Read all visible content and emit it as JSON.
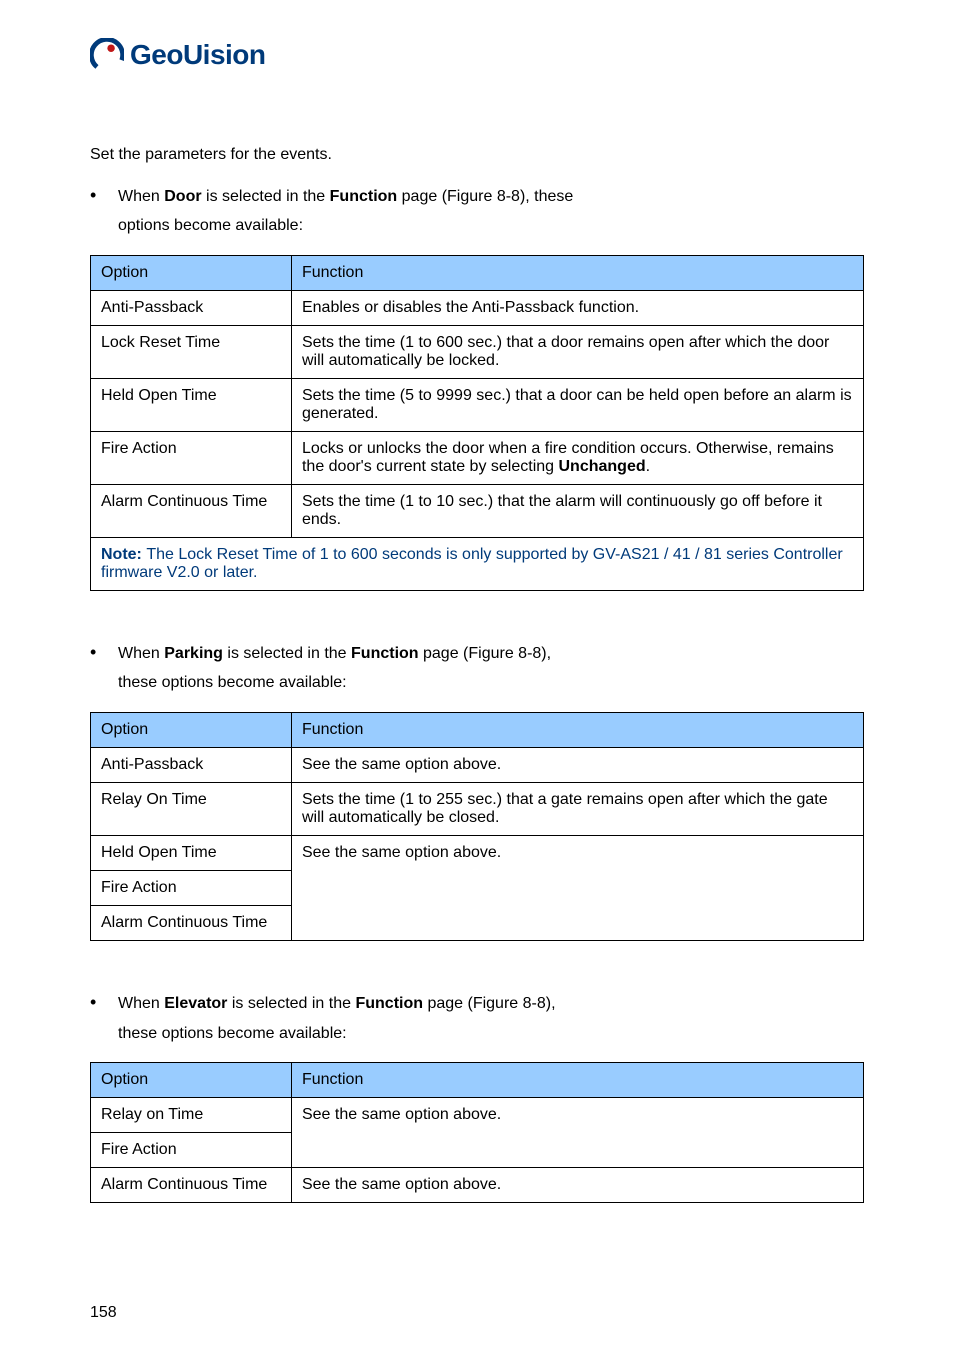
{
  "logo_text": "GeoUision",
  "intro": "Set the parameters for the events.",
  "bullet1": {
    "when": "When ",
    "mode": "Door",
    "middle": " is selected in the ",
    "field": "Function",
    "tail": " page (Figure 8-8), these",
    "cont": "options become available:"
  },
  "table1": {
    "h_option": "Option",
    "h_func": "Function",
    "r1_o": "Anti-Passback",
    "r1_f": "Enables or disables the Anti-Passback function.",
    "r2_o": "Lock Reset Time",
    "r2_f": "Sets the time (1 to 600 sec.) that a door remains open after which the door will automatically be locked.",
    "r3_o": "Held Open Time",
    "r3_f": "Sets the time (5 to 9999 sec.) that a door can be held open before an alarm is generated.",
    "r4_o": "Fire Action",
    "r4_f_a": "Locks or unlocks the door when a fire condition occurs. Otherwise, remains the door's current state by selecting ",
    "r4_f_b": "Unchanged",
    "r4_f_c": ".",
    "r5_o": "Alarm Continuous Time",
    "r5_f": "Sets the time (1 to 10 sec.) that the alarm will continuously go off before it ends.",
    "note_label": "Note: ",
    "note_text": "The Lock Reset Time of 1 to 600 seconds is only supported by GV-AS21 / 41 / 81 series Controller firmware V2.0 or later."
  },
  "bullet2": {
    "when": "When ",
    "mode": "Parking",
    "middle": " is selected in the ",
    "field": "Function",
    "tail": " page (Figure 8-8),",
    "cont": "these options become available:"
  },
  "table2": {
    "h_option": "Option",
    "h_func": "Function",
    "r1_o": "Anti-Passback",
    "r1_f": "See the same option above.",
    "r2_o": "Relay On Time",
    "r2_f": "Sets the time (1 to 255 sec.) that a gate remains open after which the gate will automatically be closed.",
    "r3_o": "Held Open Time",
    "r3_f": "See the same option above.",
    "r4_o": "Fire Action",
    "r5_o": "Alarm Continuous Time"
  },
  "bullet3": {
    "when": "When ",
    "mode": "Elevator",
    "middle": " is selected in the ",
    "field": "Function",
    "tail": " page (Figure 8-8),",
    "cont": "these options become available:"
  },
  "table3": {
    "h_option": "Option",
    "h_func": "Function",
    "r1_o": "Relay on Time",
    "r1_f": "See the same option above.",
    "r2_o": "Fire Action",
    "r3_o": "Alarm Continuous Time",
    "r3_f": "See the same option above."
  },
  "page_number": "158"
}
